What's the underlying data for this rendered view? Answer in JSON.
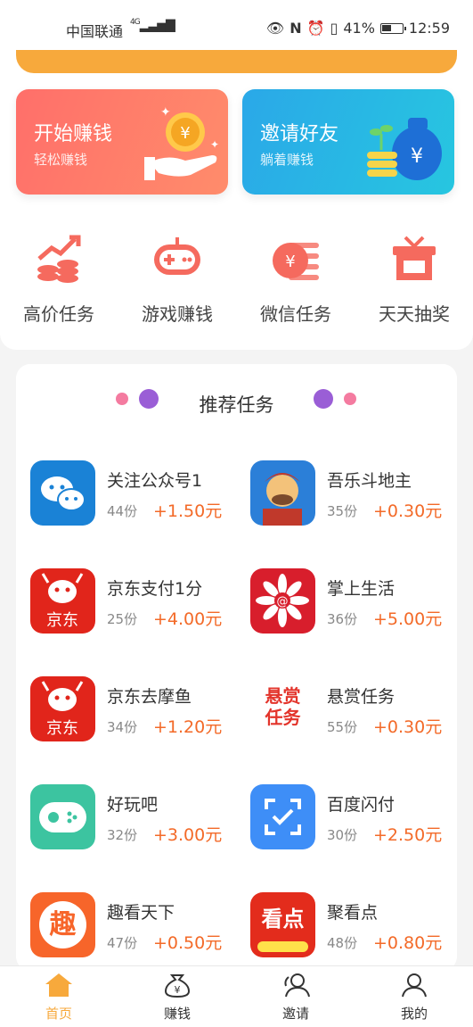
{
  "status_bar": {
    "carrier": "中国联通",
    "network": "4G",
    "battery": "41%",
    "time": "12:59"
  },
  "promos": [
    {
      "title": "开始赚钱",
      "subtitle": "轻松赚钱"
    },
    {
      "title": "邀请好友",
      "subtitle": "躺着赚钱"
    }
  ],
  "categories": [
    {
      "label": "高价任务",
      "icon": "chart-coins-icon"
    },
    {
      "label": "游戏赚钱",
      "icon": "gamepad-icon"
    },
    {
      "label": "微信任务",
      "icon": "yuan-coin-icon"
    },
    {
      "label": "天天抽奖",
      "icon": "gift-box-icon"
    }
  ],
  "recommended": {
    "title": "推荐任务",
    "tasks": [
      {
        "name": "关注公众号1",
        "count": "44份",
        "reward": "+1.50元",
        "icon": "wechat-icon",
        "color": "#1a82d6"
      },
      {
        "name": "吾乐斗地主",
        "count": "35份",
        "reward": "+0.30元",
        "icon": "doudizhu-icon",
        "color": "#2b7fd8"
      },
      {
        "name": "京东支付1分",
        "count": "25份",
        "reward": "+4.00元",
        "icon": "jd-icon",
        "color": "#e1251b"
      },
      {
        "name": "掌上生活",
        "count": "36份",
        "reward": "+5.00元",
        "icon": "flower-icon",
        "color": "#d81e2c"
      },
      {
        "name": "京东去摩鱼",
        "count": "34份",
        "reward": "+1.20元",
        "icon": "jd-icon",
        "color": "#e1251b"
      },
      {
        "name": "悬赏任务",
        "count": "55份",
        "reward": "+0.30元",
        "icon": "bounty-text-icon",
        "color": "#ffffff",
        "icon_text": "悬赏任务"
      },
      {
        "name": "好玩吧",
        "count": "32份",
        "reward": "+3.00元",
        "icon": "gamepad-icon",
        "color": "#3cc4a0"
      },
      {
        "name": "百度闪付",
        "count": "30份",
        "reward": "+2.50元",
        "icon": "scan-check-icon",
        "color": "#3e8ef7"
      },
      {
        "name": "趣看天下",
        "count": "47份",
        "reward": "+0.50元",
        "icon": "qu-icon",
        "color": "#f7652a",
        "icon_text": "趣"
      },
      {
        "name": "聚看点",
        "count": "48份",
        "reward": "+0.80元",
        "icon": "kandian-icon",
        "color": "#e32c1c",
        "icon_text": "看点"
      }
    ]
  },
  "tabs": [
    {
      "label": "首页",
      "icon": "home-icon",
      "active": true
    },
    {
      "label": "赚钱",
      "icon": "money-bag-icon",
      "active": false
    },
    {
      "label": "邀请",
      "icon": "invite-user-icon",
      "active": false
    },
    {
      "label": "我的",
      "icon": "profile-icon",
      "active": false
    }
  ]
}
